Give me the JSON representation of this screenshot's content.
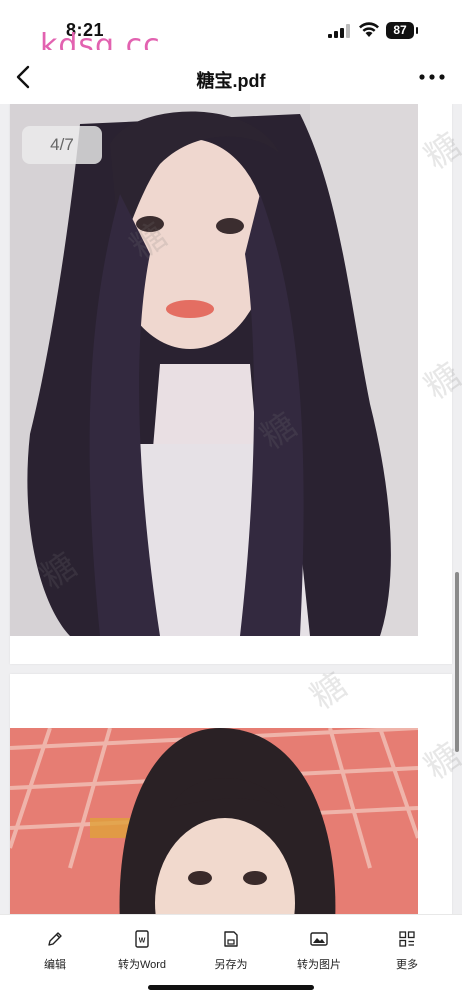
{
  "status_bar": {
    "time": "8:21",
    "battery": "87",
    "watermark": "kdsq.cc"
  },
  "nav": {
    "title": "糖宝.pdf",
    "back_icon": "chevron-left-icon",
    "more_icon": "more-horizontal-icon"
  },
  "viewer": {
    "page_indicator": "4/7",
    "watermark_char": "糖"
  },
  "toolbar": {
    "items": [
      {
        "label": "编辑",
        "icon": "pencil-icon"
      },
      {
        "label": "转为Word",
        "icon": "word-document-icon"
      },
      {
        "label": "另存为",
        "icon": "save-as-icon"
      },
      {
        "label": "转为图片",
        "icon": "image-icon"
      },
      {
        "label": "更多",
        "icon": "grid-more-icon"
      }
    ]
  },
  "colors": {
    "watermark": "#e262b0",
    "background": "#f2f2f4"
  }
}
